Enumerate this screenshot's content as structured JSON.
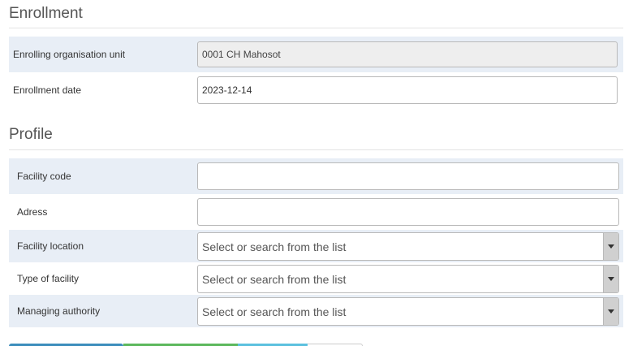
{
  "enrollment": {
    "title": "Enrollment",
    "org_unit": {
      "label": "Enrolling organisation unit",
      "value": "0001 CH Mahosot"
    },
    "date": {
      "label": "Enrollment date",
      "value": "2023-12-14"
    }
  },
  "profile": {
    "title": "Profile",
    "facility_code": {
      "label": "Facility code",
      "value": ""
    },
    "address": {
      "label": "Adress",
      "value": ""
    },
    "facility_location": {
      "label": "Facility location",
      "placeholder": "Select or search from the list"
    },
    "facility_type": {
      "label": "Type of facility",
      "placeholder": "Select or search from the list"
    },
    "managing_authority": {
      "label": "Managing authority",
      "placeholder": "Select or search from the list"
    }
  },
  "colors": {
    "row_shade": "#e8eef6",
    "button_blue": "#3c8dbc",
    "button_green": "#5cb85c",
    "button_cyan": "#5bc0de"
  }
}
